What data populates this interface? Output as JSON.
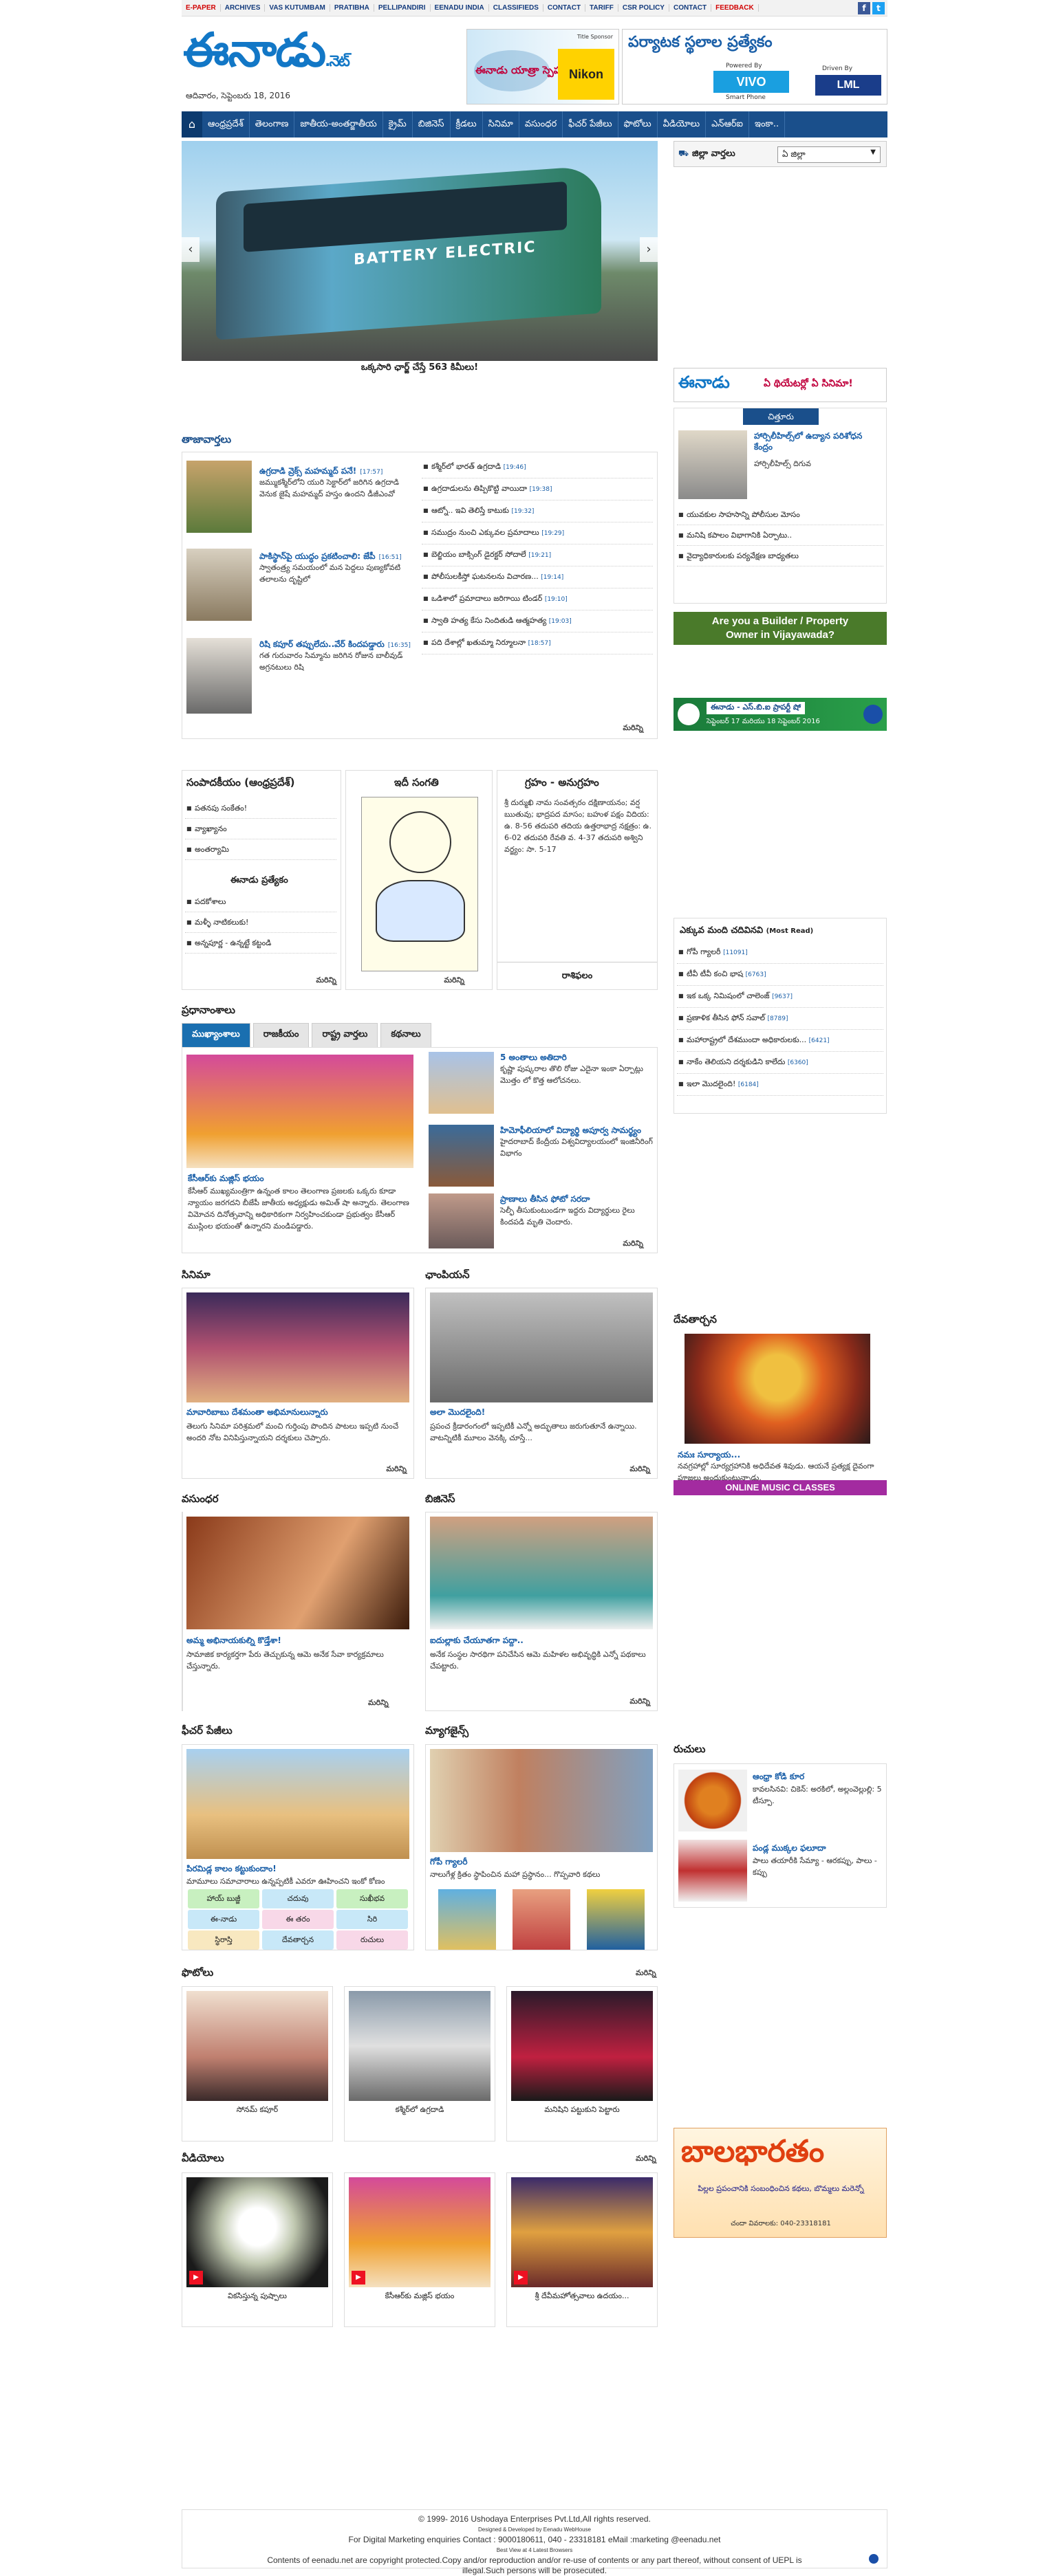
{
  "topbar": {
    "links": [
      "E-PAPER",
      "ARCHIVES",
      "VAS KUTUMBAM",
      "PRATIBHA",
      "PELLIPANDIRI",
      "EENADU INDIA",
      "CLASSIFIEDS",
      "CONTACT",
      "TARIFF",
      "CSR POLICY",
      "CONTACT",
      "FEEDBACK"
    ]
  },
  "header": {
    "logo": "ఈనాడు",
    "logo_suffix": ".నెట్",
    "date": "ఆదివారం, సెప్టెంబరు 18, 2016",
    "ad1_title": "ఈనాడు యాత్రా స్పెషల్",
    "ad1_sponsor": "Title Sponsor",
    "ad1_brand": "Nikon",
    "ad2_title": "పర్యాటక స్థలాల ప్రత్యేకం",
    "ad2_powered": "Powered By",
    "ad2_brand": "VIVO",
    "ad2_sub": "Smart Phone",
    "ad2_driven": "Driven By",
    "ad2_brand2": "LML"
  },
  "nav": {
    "items": [
      "ఆంధ్రప్రదేశ్",
      "తెలంగాణ",
      "జాతీయ-అంతర్జాతీయ",
      "క్రైమ్",
      "బిజినెస్",
      "క్రీడలు",
      "సినిమా",
      "వసుంధర",
      "ఫీచర్ పేజీలు",
      "ఫొటోలు",
      "వీడియోలు",
      "ఎన్ఆర్ఐ",
      "ఇంకా.."
    ]
  },
  "slider": {
    "caption": "ఒక్కసారి ఛార్జ్ చేస్తే 563 కిమీలు!",
    "bus_text": "BATTERY ELECTRIC"
  },
  "district": {
    "label": "జిల్లా వార్తలు",
    "select": "ఏ జిల్లా"
  },
  "latest": {
    "title": "తాజావార్తలు",
    "more": "మరిన్ని",
    "main": [
      {
        "headline": "ఉగ్రదాడి వ్రెక్స్ మహమ్మద్ పనే!",
        "time": "[17:57]",
        "text": "జమ్ముకశ్మీర్‌లోని యురి సెక్టార్‌లో జరిగిన ఉగ్రదాడి వెనుక జైషే మహమ్మద్ హస్తం ఉందని డీజీఎంవో"
      },
      {
        "headline": "పాకిస్థాన్‌పై యుద్ధం ప్రకటించాలి: జేపీ",
        "time": "[16:51]",
        "text": "స్వాతంత్ర్య సమయంలో మన పెద్దలు పుణ్యకోవటి తలాలను దృష్టిలో"
      },
      {
        "headline": "రిషి కపూర్ తప్పులేదు..వేర్ కిందపడ్డారు",
        "time": "[16:35]",
        "text": "గత గురువారం సిమ్మాను జరిగిన రోజున బాలీవుడ్ అగ్రనటులు రిషి"
      }
    ],
    "list": [
      {
        "t": "కశ్మీర్‌లో భారత్ ఉగ్రదాడి",
        "ts": "[19:46]"
      },
      {
        "t": "ఉగ్రదాడులను తిప్పికొట్టి వాయిదా",
        "ts": "[19:38]"
      },
      {
        "t": "ఆట్నో.. ఇవి తెలిస్తే కాటుకు",
        "ts": "[19:32]"
      },
      {
        "t": "సముద్రం నుంచి ఎక్కువల ప్రమాదాలు",
        "ts": "[19:29]"
      },
      {
        "t": "బెల్జియం బాక్సింగ్ డైరక్టర్ సోదాలే",
        "ts": "[19:21]"
      },
      {
        "t": "పోలీసులకీస్తో ఘటనలను విచారణ...",
        "ts": "[19:14]"
      },
      {
        "t": "ఒడిశాలో ప్రమాదాలు జరిగాయి టిండర్",
        "ts": "[19:10]"
      },
      {
        "t": "స్వాతి హత్య కేసు నిందితుడి ఆత్మహత్య",
        "ts": "[19:03]"
      },
      {
        "t": "పది దేశాల్లో ఖతుమ్మా నిర్మూలనా",
        "ts": "[18:57]"
      }
    ]
  },
  "eenadu_ad": {
    "title": "ఈనాడు",
    "sub": "ఏ థియేటర్లో ఏ సినిమా!"
  },
  "chittoor": {
    "title": "చిత్తూరు",
    "headline": "హార్సిలీహిల్స్‌లో ఉద్యాన పరిశోధన కేంద్రం",
    "sub": "హార్సిలీహిల్స్‌ దిగువ",
    "items": [
      "యువకుల సాహసాన్ని పోలీసుల మోసం",
      "మనిషి కపాలం విభాగానికి ఏర్పాటు..",
      "వైద్యాధికారులకు పర్యవేక్షణ బాధ్యతలు"
    ]
  },
  "builder_ad": {
    "line1": "Are you a Builder / Property",
    "line2": "Owner in Vijayawada?"
  },
  "property_ad": {
    "text": "ఈనాడు - ఎస్.బి.ఐ ప్రాపర్టీ షో",
    "date": "సెప్టెంబర్ 17 మరియు 18 సెప్టెంబర్ 2016"
  },
  "editorial": {
    "title": "సంపాదకీయం (ఆంధ్రప్రదేశ్)",
    "items": [
      "పతనపు సంకేతం!",
      "వ్యాఖ్యానం",
      "అంతర్యామి"
    ],
    "sub_title": "ఈనాడు ప్రత్యేకం",
    "sub_items": [
      "పదకోశాలు",
      "మళ్ళీ నాటికలుకు!",
      "అన్నపూర్ణ - ఉన్నట్టే కట్టండి"
    ],
    "more": "మరిన్ని"
  },
  "cartoon": {
    "title": "ఇదీ సంగతి",
    "more": "మరిన్ని"
  },
  "grahanam": {
    "title": "గ్రహం - అనుగ్రహం",
    "text": "శ్రీ దుర్ముఖి నామ సంవత్సరం దక్షిణాయనం; వర్ష ఋతువు; భాద్రపద మాసం; బహుళ పక్షం విదియ: ఉ. 8-56 తదుపరి తదియ ఉత్తరాభాద్ర నక్షత్రం: ఉ. 6-02 తదుపరి రేవతి వ. 4-37 తదుపరి అశ్విని వర్జ్యం: సా. 5-17",
    "footer": "రాశిఫలం"
  },
  "most_read": {
    "title": "ఎక్కువ మంది చదివినవి",
    "title_en": "(Most Read)",
    "items": [
      {
        "t": "గోపీ గ్యాలరీ",
        "c": "[11091]"
      },
      {
        "t": "టీవీ టీవీ కంచి భాష",
        "c": "[6763]"
      },
      {
        "t": "ఇక ఒక్క నిమిషంలో చాలెంజ్",
        "c": "[9637]"
      },
      {
        "t": "ప్రణాళిక తీసిన ఫోన్ సవాల్",
        "c": "[8789]"
      },
      {
        "t": "మహారాష్ట్రలో దేశముందా అధికారులకు...",
        "c": "[6421]"
      },
      {
        "t": "నాకేం తెలియని దర్శకుడిని కాలేదు",
        "c": "[6360]"
      },
      {
        "t": "ఇలా మొదలైంది!",
        "c": "[6184]"
      }
    ]
  },
  "pradhana": {
    "title": "ప్రధానాంశాలు",
    "tabs": [
      "ముఖ్యాంశాలు",
      "రాజకీయం",
      "రాష్ట్ర వార్తలు",
      "కథనాలు"
    ],
    "lead_headline": "కేసీఆర్‌కు మజ్లిస్ భయం",
    "lead_text": "కేసీఆర్ ముఖ్యమంత్రిగా ఉన్నంత కాలం తెలంగాణ ప్రజలకు ఒక్కరు కూడా న్యాయం జరగదని బీజేపీ జాతీయ అధ్యక్షుడు అమిత్ షా అన్నారు. తెలంగాణ విమోచన దినోత్సవాన్ని అధికారికంగా నిర్వహించకుండా ప్రభుత్వం కేసీఆర్ ముస్లింల భయంతో ఉన్నారని మండిపడ్డారు.",
    "items": [
      {
        "h": "5 అంతాలు అతిదారి",
        "t": "కృష్ణా పుష్కరాల తొలి రోజు ఎదైనా ఇంకా ఏర్పాట్లు మొత్తం లో కొత్త ఆలోచనలు."
      },
      {
        "h": "హిమోఫీలియాలో విద్యార్థి అపూర్వ సామర్థ్యం",
        "t": "హైదరాబాద్ కేంద్రీయ విశ్వవిద్యాలయంలో ఇంజినీరింగ్ విభాగం"
      },
      {
        "h": "ప్రాణాలు తీసిన ఫోటో సరదా",
        "t": "సెల్ఫీ తీసుకుంటుండగా ఇద్దరు విద్యార్థులు రైలు కిందపడి మృతి చెందారు."
      }
    ],
    "more": "మరిన్ని"
  },
  "cinema": {
    "title": "సినిమా",
    "headline": "మావారిబాబు దేశమంతా అభిమానులున్నారు",
    "text": "తెలుగు సినిమా పరిశ్రమలో మంచి గుర్తింపు పొందిన పాటలు ఇప్పటి నుంచే అందరి నోట వినిపిస్తున్నాయని దర్శకులు చెప్పారు.",
    "more": "మరిన్ని"
  },
  "champion": {
    "title": "ఛాంపియన్",
    "headline": "అలా మొదలైంది!",
    "text": "ప్రపంచ క్రీడారంగంలో ఇప్పటికీ ఎన్నో అద్భుతాలు జరుగుతూనే ఉన్నాయి. వాటన్నిటికీ మూలం వెనక్కి చూస్తే...",
    "more": "మరిన్ని"
  },
  "devatarchana": {
    "title": "దేవతార్చన",
    "headline": "నమః సూర్యాయ...",
    "text": "నవగ్రహాల్లో సూర్యగ్రహానికి అధిదేవత శివుడు. ఆయనే ప్రత్యక్ష దైవంగా పూజలు అందుకుంటున్నాడు."
  },
  "music_ad": {
    "text": "ONLINE MUSIC CLASSES"
  },
  "vasundhara": {
    "title": "వసుంధర",
    "headline": "అమ్మ అభినాయకుల్ని కొడ్తేశా!",
    "text": "సామాజిక కార్యకర్తగా పేరు తెచ్చుకున్న ఆమె అనేక సేవా కార్యక్రమాలు చేస్తున్నారు.",
    "more": "మరిన్ని"
  },
  "business": {
    "title": "బిజినెస్",
    "headline": "ఐదుల్లాకు చేయూతగా పద్దా..",
    "text": "అనేక సంస్థల సారథిగా పనిచేసిన ఆమె మహిళల అభివృద్ధికి ఎన్నో పథకాలు చేపట్టారు.",
    "more": "మరిన్ని"
  },
  "ruchulu": {
    "title": "రుచులు",
    "items": [
      {
        "h": "ఆంధ్రా కోడి కూర",
        "t": "కావలసినవి: చికెన్: అరకిలో, అల్లంవెల్లుల్లి: 5 టీస్పూ."
      },
      {
        "h": "పండ్ల ముక్కల ఫలూదా",
        "t": "పాలు తయారీకి సేమ్యా - ఆరకప్పు, పాలు - కప్పు"
      }
    ]
  },
  "features": {
    "title": "ఫీచర్ పేజీలు",
    "headline": "పిరమిడ్ల కాలం కట్టుకుందాం!",
    "text": "మామూలు సమాచారాలు ఉన్నప్పటికీ ఎవరూ ఊహించని ఇంకో కోణం",
    "chips": [
      "హాయ్ బుజ్జీ",
      "చదువు",
      "సుఖీభవ",
      "ఈ-నాడు",
      "ఈ తరం",
      "సిరి",
      "స్థిరాస్తి",
      "దేవతార్చన",
      "రుచులు"
    ]
  },
  "magazine": {
    "title": "మ్యాగజైన్స్",
    "headline": "గోపీ గ్యాలరీ",
    "text": "నాలుగేళ్ల క్రితం స్థాపించిన మహా ప్రస్థానం... గొప్పవారి కథలు"
  },
  "photos": {
    "title": "ఫొటోలు",
    "more": "మరిన్ని",
    "items": [
      "సోనమ్ కపూర్",
      "కశ్మీర్‌లో ఉగ్రదాడి",
      "మనిషిని పట్టుకుని పెట్టారు"
    ]
  },
  "balabharatam_ad": {
    "title": "బాలభారతం",
    "text": "పిల్లల ప్రపంచానికి సంబంధించిన కథలు, బొమ్మలు మరెన్నో",
    "sub": "చందా వివరాలకు: 040-23318181"
  },
  "videos": {
    "title": "వీడియోలు",
    "more": "మరిన్ని",
    "items": [
      "వికసిస్తున్న పుష్పాలు",
      "కేసీఆర్‌కు మజ్లిస్ భయం",
      "శ్రీ దేవీమహోత్సవాలు ఉదయం..."
    ]
  },
  "footer": {
    "line1": "© 1999- 2016 Ushodaya Enterprises Pvt.Ltd,All rights reserved.",
    "line2": "Designed & Developed by Eenadu WebHouse",
    "line3": "For Digital Marketing enquiries Contact : 9000180611, 040 - 23318181 eMail :marketing @eenadu.net",
    "line4": "Best View at 4 Latest Browsers",
    "line5": "Contents of eenadu.net are copyright protected.Copy and/or reproduction and/or re-use of contents or any part thereof, without consent of UEPL is illegal.Such persons will be prosecuted."
  }
}
